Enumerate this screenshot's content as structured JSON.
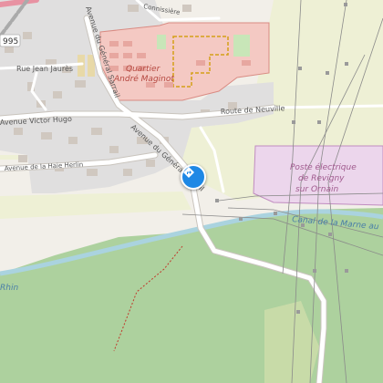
{
  "map": {
    "colors": {
      "background": "#f2efe9",
      "forest": "#add19e",
      "military": "#f4c9c3",
      "substation": "#ecd6ec",
      "farmland": "#eef0d5",
      "residential": "#e0dfdf",
      "water": "#aad3df",
      "road": "#ffffff",
      "road_casing": "#c9c4bd",
      "label": "#555555",
      "pink_label": "#a05a8e",
      "water_label": "#4a7fa8",
      "military_label": "#b5473f"
    },
    "labels": {
      "road_number": "995",
      "rue_jean_jaures": "Rue Jean Jaurès",
      "avenue_general_sarrail_top": "Avenue du Général Sarrail",
      "avenue_victor_hugo": "Avenue Victor Hugo",
      "avenue_haie_herlin": "Avenue de la Haie Herlin",
      "avenue_general_sarrail_mid": "Avenue du Général Sarrail",
      "route_neuville": "Route de Neuville",
      "connissiere": "Connissière",
      "quartier_line1": "Quartier",
      "quartier_line2": "André Maginot",
      "poste_line1": "Poste électrique",
      "poste_line2": "de Revigny",
      "poste_line3": "sur Ornain",
      "canal": "Canal de la Marne au",
      "rhin": "Rhin"
    },
    "marker": {
      "icon": "directions-icon"
    }
  }
}
